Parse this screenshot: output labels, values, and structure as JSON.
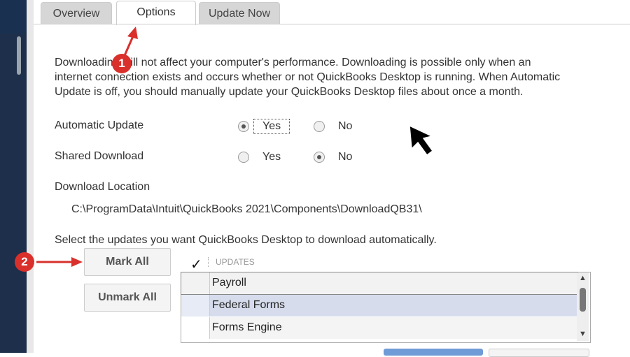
{
  "tabs": [
    {
      "label": "Overview"
    },
    {
      "label": "Options"
    },
    {
      "label": "Update Now"
    }
  ],
  "description": [
    "Downloading will not affect your computer's performance.  Downloading is possible only when an",
    "internet connection exists and occurs whether or not QuickBooks Desktop is running. When Automatic",
    "Update is off, you should manually update your QuickBooks Desktop files about once a month."
  ],
  "automatic_update": {
    "label": "Automatic Update",
    "yes": "Yes",
    "no": "No",
    "selected": "Yes"
  },
  "shared_download": {
    "label": "Shared Download",
    "yes": "Yes",
    "no": "No",
    "selected": "No"
  },
  "download_location": {
    "label": "Download Location",
    "path": "C:\\ProgramData\\Intuit\\QuickBooks 2021\\Components\\DownloadQB31\\"
  },
  "select_prompt": "Select the updates you want QuickBooks Desktop to download automatically.",
  "buttons": {
    "mark_all": "Mark All",
    "unmark_all": "Unmark All"
  },
  "updates": {
    "check_header": "✓",
    "header": "UPDATES",
    "items": [
      {
        "label": "Payroll",
        "checked": false
      },
      {
        "label": "Federal Forms",
        "checked": false
      },
      {
        "label": "Forms Engine",
        "checked": false
      }
    ]
  },
  "annotations": {
    "one": "1",
    "two": "2",
    "color": "#d9302c"
  }
}
